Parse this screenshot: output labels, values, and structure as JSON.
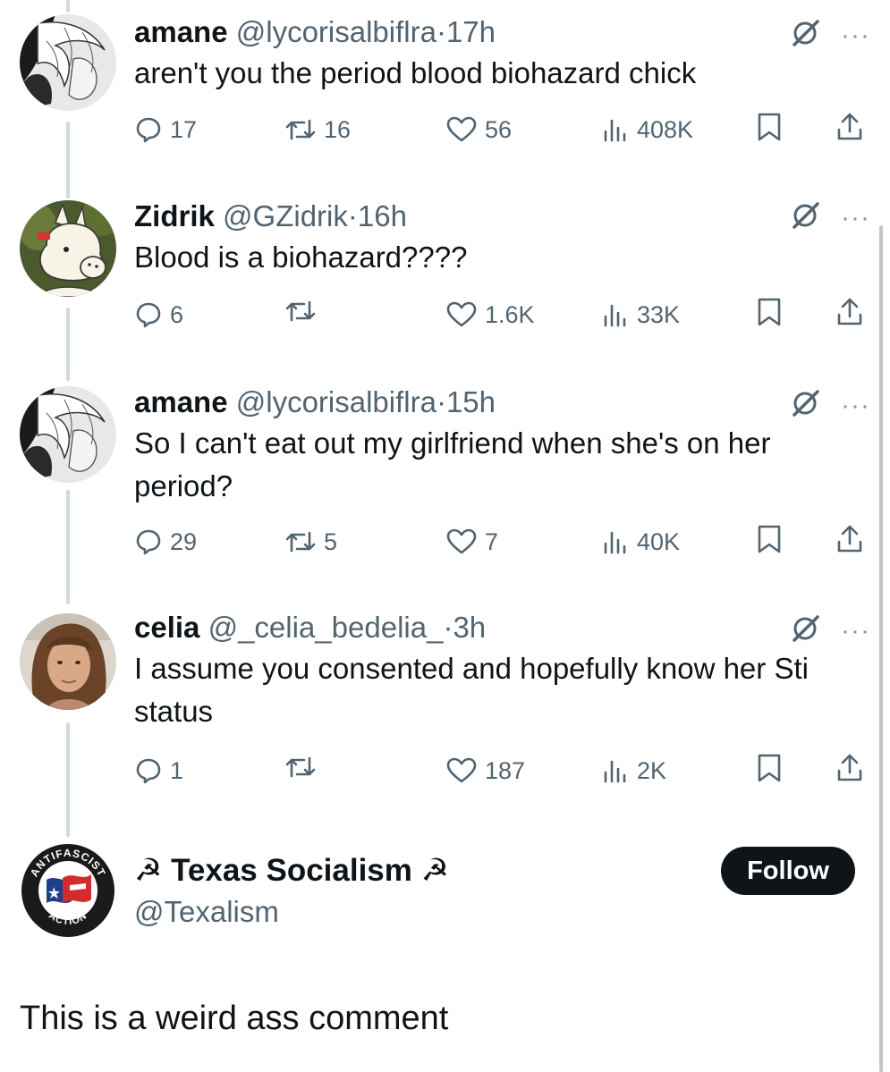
{
  "tweets": [
    {
      "name": "amane",
      "handle": "@lycorisalbiflra",
      "dot": "·",
      "time": "17h",
      "text": "aren't you the period blood biohazard chick",
      "replies": "17",
      "reposts": "16",
      "likes": "56",
      "views": "408K"
    },
    {
      "name": "Zidrik",
      "handle": "@GZidrik",
      "dot": "·",
      "time": "16h",
      "text": "Blood is a biohazard????",
      "replies": "6",
      "reposts": "",
      "likes": "1.6K",
      "views": "33K"
    },
    {
      "name": "amane",
      "handle": "@lycorisalbiflra",
      "dot": "·",
      "time": "15h",
      "text": "So I can't eat out my girlfriend when she's on her period?",
      "replies": "29",
      "reposts": "5",
      "likes": "7",
      "views": "40K"
    },
    {
      "name": "celia",
      "handle": "@_celia_bedelia_",
      "dot": "·",
      "time": "3h",
      "text": "I assume you consented and hopefully know her Sti status",
      "replies": "1",
      "reposts": "",
      "likes": "187",
      "views": "2K"
    }
  ],
  "focused": {
    "name": "☭ Texas Socialism ☭",
    "handle": "@Texalism",
    "follow_label": "Follow",
    "text": "This is a weird ass comment",
    "avatar_top_text": "ANTIFASCIST",
    "avatar_bottom_text": "ACTION"
  },
  "icons": {
    "reply": "reply-icon",
    "repost": "repost-icon",
    "like": "heart-icon",
    "views": "views-icon",
    "bookmark": "bookmark-icon",
    "share": "share-icon",
    "grok": "grok-icon",
    "more": "more-icon"
  },
  "colors": {
    "text": "#0f1419",
    "secondary": "#536471",
    "thread_line": "#cfd9de",
    "follow_bg": "#0f1419"
  }
}
